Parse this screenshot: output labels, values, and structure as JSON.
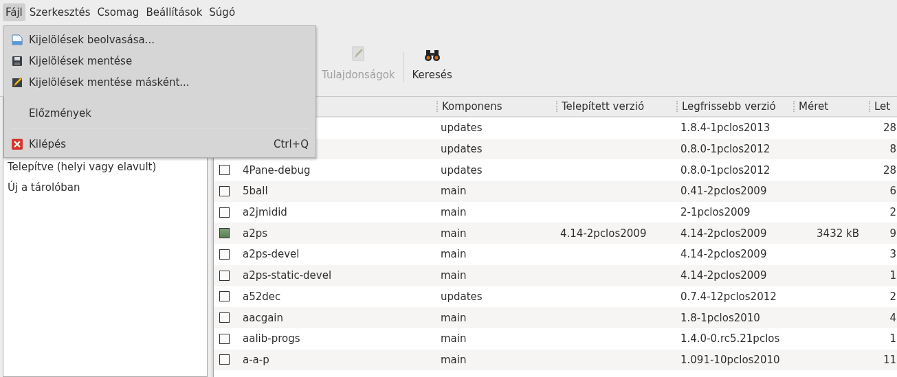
{
  "menubar": [
    {
      "label": "Fájl",
      "selected": true
    },
    {
      "label": "Szerkesztés",
      "selected": false
    },
    {
      "label": "Csomag",
      "selected": false
    },
    {
      "label": "Beállítások",
      "selected": false
    },
    {
      "label": "Súgó",
      "selected": false
    }
  ],
  "file_menu": [
    {
      "kind": "item",
      "label": "Kijelölések beolvasása..."
    },
    {
      "kind": "item",
      "label": "Kijelölések mentése"
    },
    {
      "kind": "item",
      "label": "Kijelölések mentése másként..."
    },
    {
      "kind": "separator"
    },
    {
      "kind": "item",
      "label": "Előzmények"
    },
    {
      "kind": "separator"
    },
    {
      "kind": "item",
      "label": "Kilépés",
      "shortcut": "Ctrl+Q"
    }
  ],
  "toolbar": [
    {
      "label": "Tulajdonságok",
      "disabled": true
    },
    {
      "label": "Keresés",
      "disabled": false
    }
  ],
  "sidebar": {
    "items": [
      {
        "label": "Telepítve (helyi vagy elavult)"
      },
      {
        "label": "Új a tárolóban"
      }
    ]
  },
  "table": {
    "columns": [
      "Komponens",
      "Telepített verzió",
      "Legfrissebb verzió",
      "Méret",
      "Let"
    ],
    "rows": [
      {
        "name": "",
        "component": "updates",
        "installed": "",
        "latest": "1.8.4-1pclos2013",
        "size": "",
        "column_7": "28"
      },
      {
        "name": "",
        "component": "updates",
        "installed": "",
        "latest": "0.8.0-1pclos2012",
        "size": "",
        "column_7": "8"
      },
      {
        "checked": false,
        "name": "4Pane-debug",
        "component": "updates",
        "installed": "",
        "latest": "0.8.0-1pclos2012",
        "size": "",
        "column_7": "28"
      },
      {
        "checked": false,
        "name": "5ball",
        "component": "main",
        "installed": "",
        "latest": "0.41-2pclos2009",
        "size": "",
        "column_7": "6"
      },
      {
        "checked": false,
        "name": "a2jmidid",
        "component": "main",
        "installed": "",
        "latest": "2-1pclos2009",
        "size": "",
        "column_7": "2"
      },
      {
        "checked": true,
        "name": "a2ps",
        "component": "main",
        "installed": "4.14-2pclos2009",
        "latest": "4.14-2pclos2009",
        "size": "3432 kB",
        "column_7": "9"
      },
      {
        "checked": false,
        "name": "a2ps-devel",
        "component": "main",
        "installed": "",
        "latest": "4.14-2pclos2009",
        "size": "",
        "column_7": "3"
      },
      {
        "checked": false,
        "name": "a2ps-static-devel",
        "component": "main",
        "installed": "",
        "latest": "4.14-2pclos2009",
        "size": "",
        "column_7": "1"
      },
      {
        "checked": false,
        "name": "a52dec",
        "component": "updates",
        "installed": "",
        "latest": "0.7.4-12pclos2012",
        "size": "",
        "column_7": "2"
      },
      {
        "checked": false,
        "name": "aacgain",
        "component": "main",
        "installed": "",
        "latest": "1.8-1pclos2010",
        "size": "",
        "column_7": "4"
      },
      {
        "checked": false,
        "name": "aalib-progs",
        "component": "main",
        "installed": "",
        "latest": "1.4.0-0.rc5.21pclos",
        "size": "",
        "column_7": "1"
      },
      {
        "checked": false,
        "name": "a-a-p",
        "component": "main",
        "installed": "",
        "latest": "1.091-10pclos2010",
        "size": "",
        "column_7": "11"
      }
    ]
  }
}
